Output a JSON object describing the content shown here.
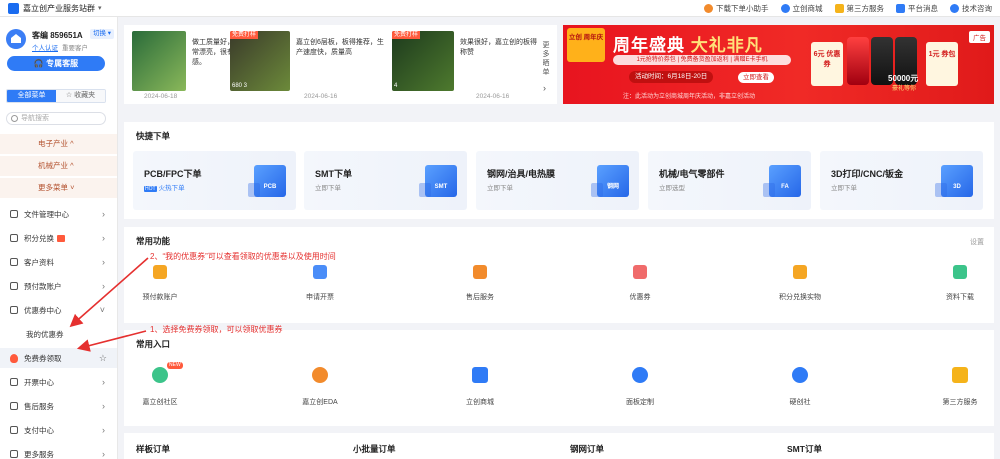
{
  "topbar": {
    "title": "嘉立创产业服务站群",
    "links": [
      {
        "label": "下载下单小助手",
        "color": "#f28b2c"
      },
      {
        "label": "立创商城",
        "color": "#2f7bf6"
      },
      {
        "label": "第三方服务",
        "color": "#f5b31a"
      },
      {
        "label": "平台消息",
        "color": "#2f7bf6"
      },
      {
        "label": "技术咨询",
        "color": "#2f7bf6"
      }
    ]
  },
  "user": {
    "name": "客编 859651A",
    "switch": "切换",
    "verify": "个人认证",
    "level": "重要客户",
    "cs_button": "专属客服"
  },
  "menu_tabs": {
    "all": "全部菜单",
    "fav": "收藏夹"
  },
  "nav_search_placeholder": "导航搜索",
  "categories": [
    "电子产业",
    "机械产业",
    "更多菜单"
  ],
  "nav": [
    {
      "label": "文件管理中心"
    },
    {
      "label": "积分兑换"
    },
    {
      "label": "客户资料"
    },
    {
      "label": "预付款账户"
    },
    {
      "label": "优惠券中心"
    },
    {
      "label": "我的优惠券"
    },
    {
      "label": "免费券领取"
    },
    {
      "label": "开票中心"
    },
    {
      "label": "售后服务"
    },
    {
      "label": "支付中心"
    },
    {
      "label": "更多服务"
    }
  ],
  "news": [
    {
      "text": "做工质量好，板子非常漂亮，很有科技感。",
      "date": "2024-06-18",
      "badge": "",
      "stats": ""
    },
    {
      "text": "嘉立创6层板，板得推荐，生产速度快，质量高",
      "date": "2024-06-16",
      "badge": "免费打样",
      "stats": "680  3"
    },
    {
      "text": "效果很好，嘉立创的板得称赞",
      "date": "2024-06-16",
      "badge": "免费打样",
      "stats": "4"
    }
  ],
  "news_more": "更多晒单",
  "banner": {
    "logo": "立创 周年庆",
    "title_a": "周年盛典",
    "title_b": "大礼非凡",
    "sub": "1元抢特价券包 | 免费备货盈加返利 | 满赠E卡手机",
    "time": "活动时间：6月18日-20日",
    "button": "立即查看",
    "note": "注：此活动为立创商城周年庆活动，非嘉立创活动",
    "ad": "广告",
    "coupon1": "6元 优惠券",
    "coupon2": "1元 券包",
    "price": "50000元",
    "price_sub": "豪礼等你"
  },
  "quick": {
    "title": "快捷下单",
    "cards": [
      {
        "title": "PCB/FPC下单",
        "sub": "火热下单",
        "hot": "HOT",
        "pic": "PCB"
      },
      {
        "title": "SMT下单",
        "sub": "立即下单",
        "hot": "",
        "pic": "SMT"
      },
      {
        "title": "钢网/治具/电热膜",
        "sub": "立即下单",
        "hot": "",
        "pic": "钢网"
      },
      {
        "title": "机械/电气零部件",
        "sub": "立即选型",
        "hot": "",
        "pic": "FA"
      },
      {
        "title": "3D打印/CNC/钣金",
        "sub": "立即下单",
        "hot": "",
        "pic": "3D"
      }
    ]
  },
  "func": {
    "title": "常用功能",
    "settings": "设置",
    "items": [
      {
        "label": "预付款账户",
        "color": "#f5a623"
      },
      {
        "label": "申请开票",
        "color": "#4a8df8"
      },
      {
        "label": "售后服务",
        "color": "#f28b2c"
      },
      {
        "label": "优惠券",
        "color": "#f06b6b"
      },
      {
        "label": "积分兑换实物",
        "color": "#f5a623"
      },
      {
        "label": "资料下载",
        "color": "#3cc48a"
      }
    ]
  },
  "entry": {
    "title": "常用入口",
    "items": [
      {
        "label": "嘉立创社区",
        "color": "#3cc48a",
        "new": "NEW"
      },
      {
        "label": "嘉立创EDA",
        "color": "#f28b2c",
        "new": ""
      },
      {
        "label": "立创商城",
        "color": "#2f7bf6",
        "new": ""
      },
      {
        "label": "面板定制",
        "color": "#2f7bf6",
        "new": ""
      },
      {
        "label": "硬创社",
        "color": "#2f7bf6",
        "new": ""
      },
      {
        "label": "第三方服务",
        "color": "#f5b31a",
        "new": ""
      }
    ]
  },
  "orders": [
    "样板订单",
    "小批量订单",
    "钢网订单",
    "SMT订单"
  ],
  "annotations": {
    "a1": "1、选择免费券领取，可以领取优惠券",
    "a2": "2、“我的优惠券”可以查看领取的优惠卷以及使用时间"
  }
}
